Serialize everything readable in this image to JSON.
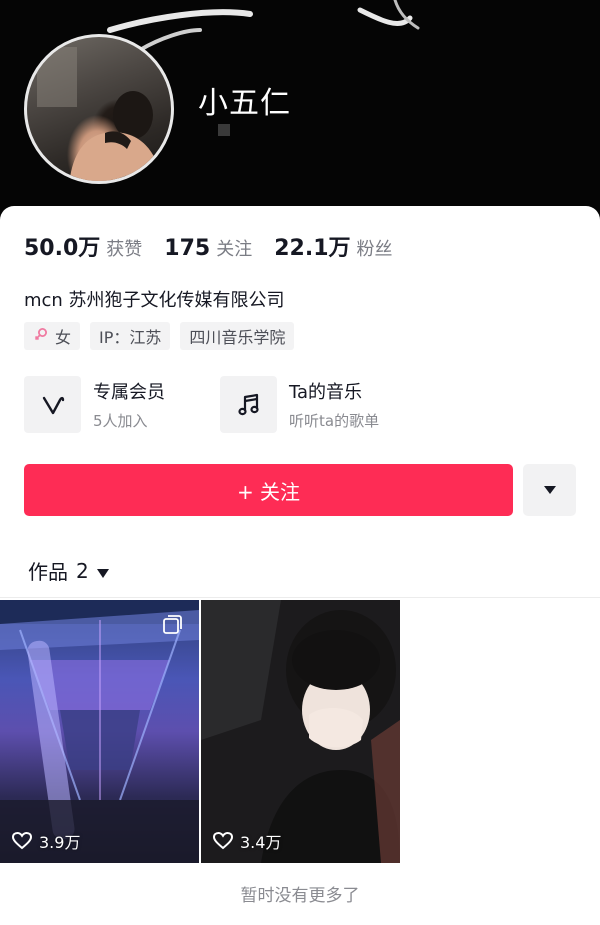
{
  "profile": {
    "name": "小五仁"
  },
  "stats": [
    {
      "value": "50.0万",
      "label": "获赞"
    },
    {
      "value": "175",
      "label": "关注"
    },
    {
      "value": "22.1万",
      "label": "粉丝"
    }
  ],
  "mcn": "mcn 苏州狍子文化传媒有限公司",
  "tags": {
    "gender": "女",
    "ip": "IP：江苏",
    "school": "四川音乐学院"
  },
  "features": {
    "membership": {
      "title": "专属会员",
      "subtitle": "5人加入",
      "icon": "v-logo-icon"
    },
    "music": {
      "title": "Ta的音乐",
      "subtitle": "听听ta的歌单",
      "icon": "music-note-icon"
    }
  },
  "actions": {
    "follow_label": "+ 关注",
    "more_icon": "triangle-down-icon"
  },
  "works": {
    "label": "作品",
    "count": "2",
    "items": [
      {
        "likes": "3.9万",
        "multi_image": true
      },
      {
        "likes": "3.4万",
        "multi_image": false
      }
    ]
  },
  "footer_note": "暂时没有更多了",
  "colors": {
    "accent": "#fe2c55",
    "header_bg": "#050505",
    "muted_text": "#8a8b91"
  }
}
